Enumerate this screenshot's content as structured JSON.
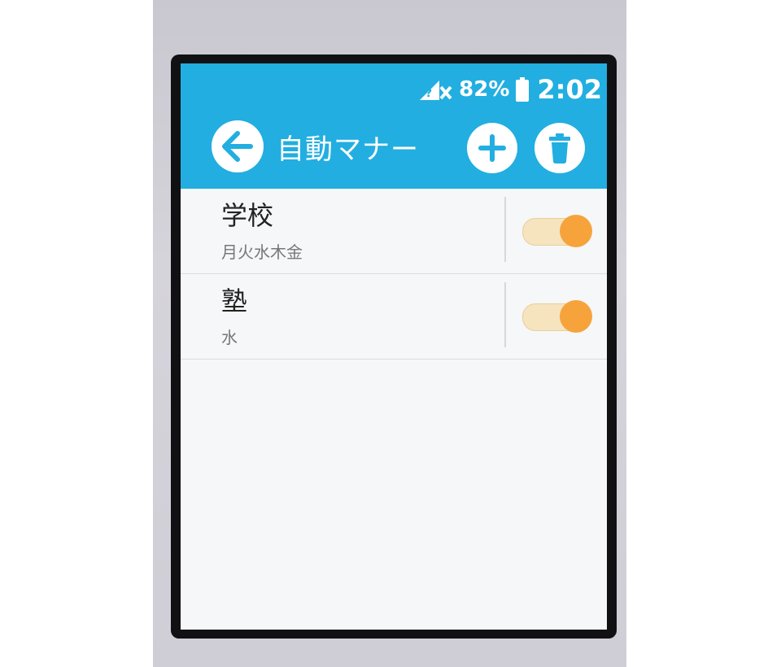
{
  "status": {
    "signal_icon": "no-sim-signal-icon",
    "battery_percent": "82%",
    "battery_icon": "battery-icon",
    "time": "2:02"
  },
  "header": {
    "title": "自動マナー",
    "back_icon": "arrow-left-icon",
    "add_icon": "plus-icon",
    "delete_icon": "trash-icon"
  },
  "list": {
    "items": [
      {
        "title": "学校",
        "days": "月火水木金",
        "enabled": true
      },
      {
        "title": "塾",
        "days": "水",
        "enabled": true
      }
    ]
  },
  "colors": {
    "appbar": "#22aee0",
    "toggle_on_thumb": "#f7a33c",
    "toggle_on_track": "#f6e4bf"
  }
}
